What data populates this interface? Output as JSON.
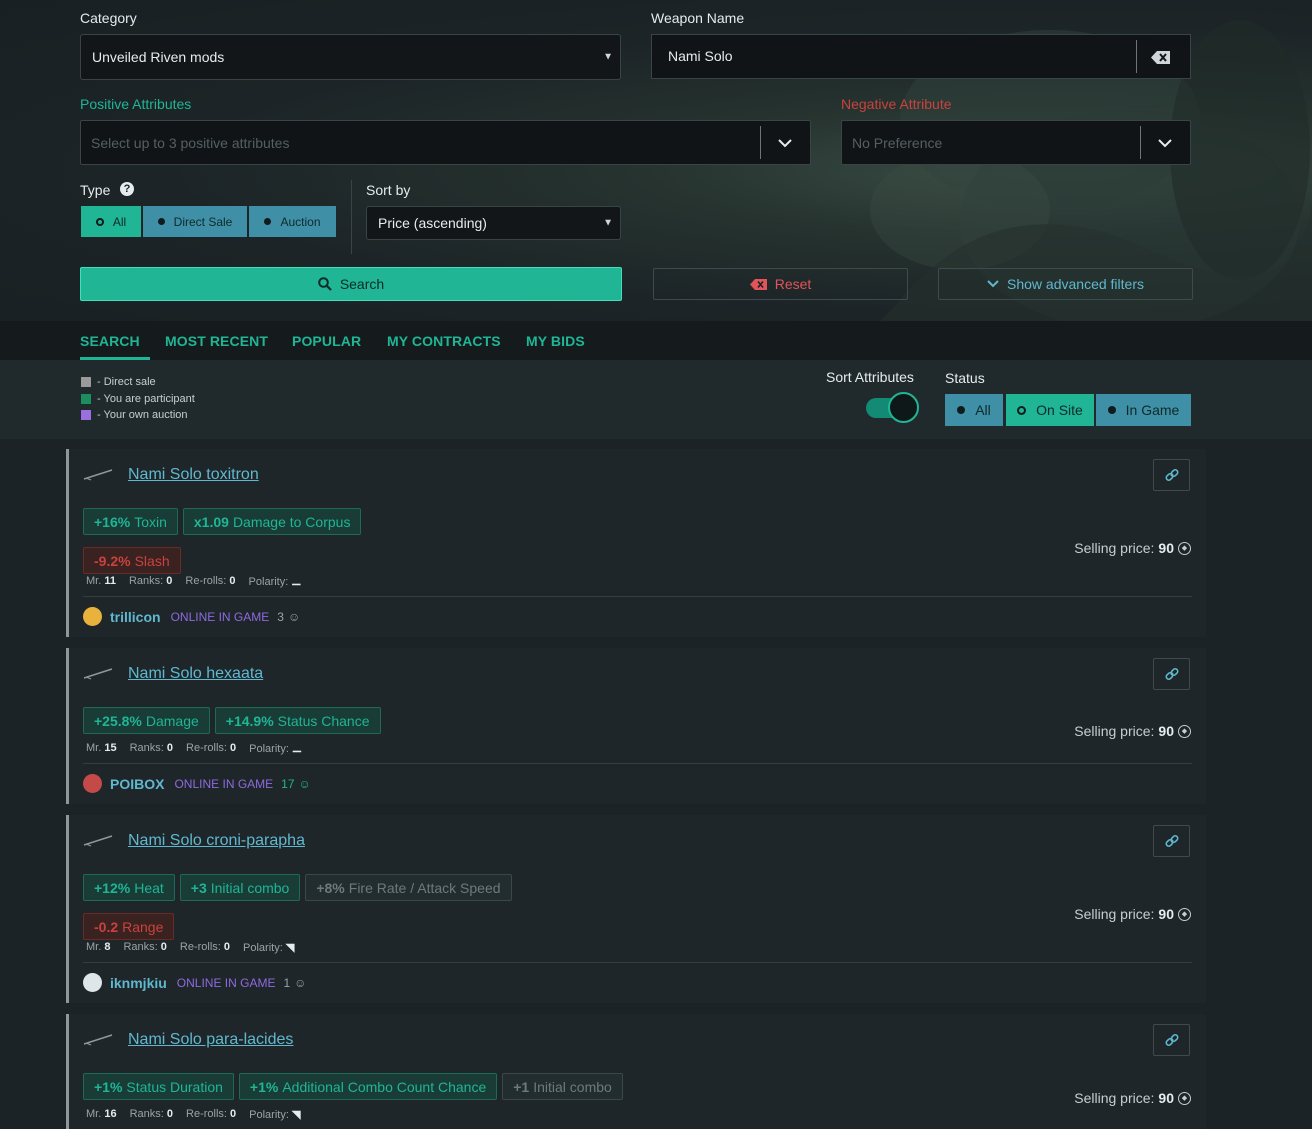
{
  "filters": {
    "category_label": "Category",
    "category_value": "Unveiled Riven mods",
    "weapon_label": "Weapon Name",
    "weapon_value": "Nami Solo",
    "positive_label": "Positive Attributes",
    "positive_placeholder": "Select up to 3 positive attributes",
    "negative_label": "Negative Attribute",
    "negative_value": "No Preference",
    "type_label": "Type",
    "type_options": [
      "All",
      "Direct Sale",
      "Auction"
    ],
    "type_selected": "All",
    "sort_label": "Sort by",
    "sort_value": "Price (ascending)",
    "search_label": "Search",
    "reset_label": "Reset",
    "advanced_label": "Show advanced filters"
  },
  "tabs": [
    "SEARCH",
    "MOST RECENT",
    "POPULAR",
    "MY CONTRACTS",
    "MY BIDS"
  ],
  "legend": [
    {
      "label": "- Direct sale",
      "color": "#9a9a9a"
    },
    {
      "label": "- You are participant",
      "color": "#1a8e5e"
    },
    {
      "label": "- Your own auction",
      "color": "#9b6fe0"
    }
  ],
  "sort_attributes": {
    "label": "Sort Attributes",
    "on": true
  },
  "status": {
    "label": "Status",
    "options": [
      "All",
      "On Site",
      "In Game"
    ],
    "selected": "On Site"
  },
  "colors": {
    "accent": "#1fb595",
    "link": "#5fb8cf",
    "negative": "#c9423e",
    "ingame": "#8e6ae0",
    "status_button": "#3f8fa6"
  },
  "auctions": [
    {
      "title": "Nami Solo toxitron",
      "attrs": [
        {
          "value": "+16%",
          "name": "Toxin",
          "kind": "pos"
        },
        {
          "value": "x1.09",
          "name": "Damage to Corpus",
          "kind": "pos"
        },
        {
          "break": true
        },
        {
          "value": "-9.2%",
          "name": "Slash",
          "kind": "neg"
        }
      ],
      "mr": "11",
      "ranks": "0",
      "rerolls": "0",
      "polarity": "⚊",
      "seller": "trillicon",
      "status": "ONLINE IN GAME",
      "rep": "3",
      "rep_positive": false,
      "price_label": "Selling price:",
      "price": "90"
    },
    {
      "title": "Nami Solo hexaata",
      "attrs": [
        {
          "value": "+25.8%",
          "name": "Damage",
          "kind": "pos"
        },
        {
          "value": "+14.9%",
          "name": "Status Chance",
          "kind": "pos"
        }
      ],
      "mr": "15",
      "ranks": "0",
      "rerolls": "0",
      "polarity": "⚊",
      "seller": "POIBOX",
      "status": "ONLINE IN GAME",
      "rep": "17",
      "rep_positive": true,
      "price_label": "Selling price:",
      "price": "90"
    },
    {
      "title": "Nami Solo croni-parapha",
      "attrs": [
        {
          "value": "+12%",
          "name": "Heat",
          "kind": "pos"
        },
        {
          "value": "+3",
          "name": "Initial combo",
          "kind": "pos"
        },
        {
          "value": "+8%",
          "name": "Fire Rate / Attack Speed",
          "kind": "dim"
        },
        {
          "break": true
        },
        {
          "value": "-0.2",
          "name": "Range",
          "kind": "neg"
        }
      ],
      "mr": "8",
      "ranks": "0",
      "rerolls": "0",
      "polarity": "◥",
      "seller": "iknmjkiu",
      "status": "ONLINE IN GAME",
      "rep": "1",
      "rep_positive": false,
      "price_label": "Selling price:",
      "price": "90"
    },
    {
      "title": "Nami Solo para-lacides",
      "attrs": [
        {
          "value": "+1%",
          "name": "Status Duration",
          "kind": "pos"
        },
        {
          "value": "+1%",
          "name": "Additional Combo Count Chance",
          "kind": "pos"
        },
        {
          "value": "+1",
          "name": "Initial combo",
          "kind": "dim"
        }
      ],
      "mr": "16",
      "ranks": "0",
      "rerolls": "0",
      "polarity": "◥",
      "seller": "",
      "status": "",
      "rep": "",
      "rep_positive": false,
      "price_label": "Selling price:",
      "price": "90"
    }
  ]
}
